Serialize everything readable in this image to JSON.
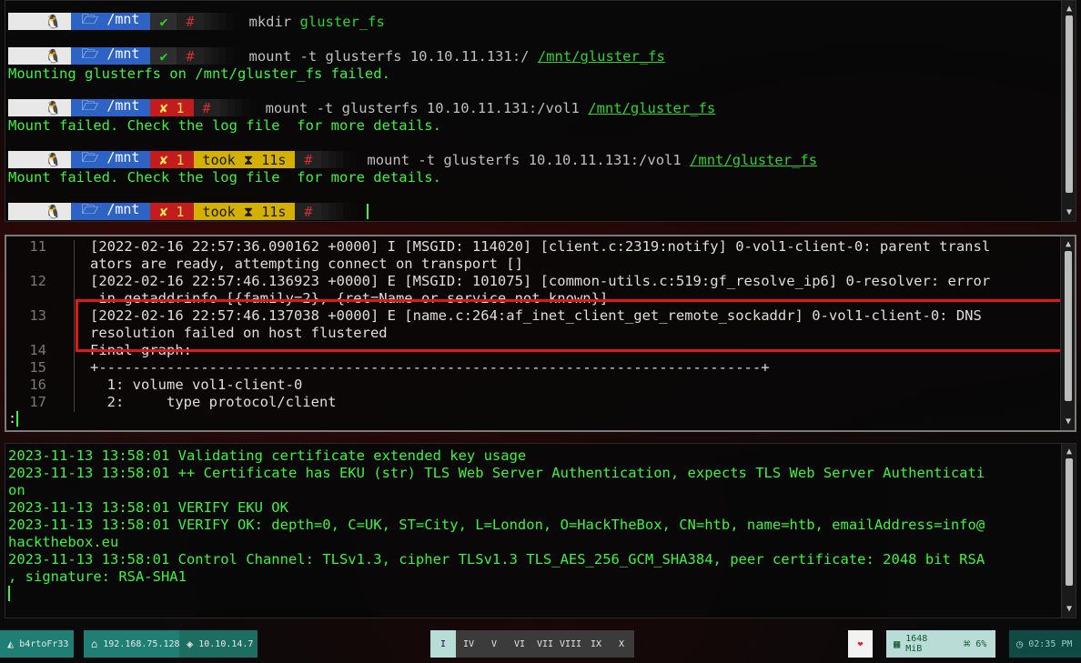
{
  "terminal_top": {
    "lines": [
      {
        "type": "prompt",
        "os_icon": "🐧",
        "dir": "🗁 /mnt",
        "status": "✔",
        "hash": "#",
        "cmd": "mkdir",
        "args": "gluster_fs"
      },
      {
        "type": "prompt",
        "os_icon": "🐧",
        "dir": "🗁 /mnt",
        "status": "✔",
        "hash": "#",
        "cmd": "mount",
        "args": "-t glusterfs 10.10.11.131:/",
        "path": "/mnt/gluster_fs"
      },
      {
        "type": "output",
        "text": "Mounting glusterfs on /mnt/gluster_fs failed."
      },
      {
        "type": "prompt",
        "os_icon": "🐧",
        "dir": "🗁 /mnt",
        "error": "✘ 1",
        "hash": "#",
        "cmd": "mount",
        "args": "-t glusterfs 10.10.11.131:/vol1",
        "path": "/mnt/gluster_fs"
      },
      {
        "type": "output",
        "text": "Mount failed. Check the log file  for more details."
      },
      {
        "type": "prompt",
        "os_icon": "🐧",
        "dir": "🗁 /mnt",
        "error": "✘ 1",
        "took": "took ⧗ 11s",
        "hash": "#",
        "cmd": "mount",
        "args": "-t glusterfs 10.10.11.131:/vol1",
        "path": "/mnt/gluster_fs"
      },
      {
        "type": "output",
        "text": "Mount failed. Check the log file  for more details."
      },
      {
        "type": "prompt",
        "os_icon": "🐧",
        "dir": "🗁 /mnt",
        "error": "✘ 1",
        "took": "took ⧗ 11s",
        "hash": "#"
      }
    ]
  },
  "vim": {
    "rows": [
      {
        "num": "11",
        "text": "[2022-02-16 22:57:36.090162 +0000] I [MSGID: 114020] [client.c:2319:notify] 0-vol1-client-0: parent transl"
      },
      {
        "num": "",
        "text": "ators are ready, attempting connect on transport []"
      },
      {
        "num": "12",
        "text": "[2022-02-16 22:57:46.136923 +0000] E [MSGID: 101075] [common-utils.c:519:gf_resolve_ip6] 0-resolver: error"
      },
      {
        "num": "",
        "text": " in getaddrinfo [{family=2}, {ret=Name or service not known}]"
      },
      {
        "num": "13",
        "text": "[2022-02-16 22:57:46.137038 +0000] E [name.c:264:af_inet_client_get_remote_sockaddr] 0-vol1-client-0: DNS"
      },
      {
        "num": "",
        "text": "resolution failed on host flustered"
      },
      {
        "num": "14",
        "text": "Final graph:"
      },
      {
        "num": "15",
        "text": "+------------------------------------------------------------------------------+"
      },
      {
        "num": "16",
        "text": "  1: volume vol1-client-0"
      },
      {
        "num": "17",
        "text": "  2:     type protocol/client"
      }
    ],
    "cmdline": ":"
  },
  "terminal_bottom": {
    "lines": [
      "2023-11-13 13:58:01 Validating certificate extended key usage",
      "2023-11-13 13:58:01 ++ Certificate has EKU (str) TLS Web Server Authentication, expects TLS Web Server Authenticati",
      "on",
      "2023-11-13 13:58:01 VERIFY EKU OK",
      "2023-11-13 13:58:01 VERIFY OK: depth=0, C=UK, ST=City, L=London, O=HackTheBox, CN=htb, name=htb, emailAddress=info@",
      "hackthebox.eu",
      "2023-11-13 13:58:01 Control Channel: TLSv1.3, cipher TLSv1.3 TLS_AES_256_GCM_SHA384, peer certificate: 2048 bit RSA",
      ", signature: RSA-SHA1"
    ]
  },
  "statusbar": {
    "user": "b4rtoFr33",
    "local_ip": "192.168.75.128",
    "vpn_ip": "10.10.14.7",
    "workspaces": [
      "I",
      "IV",
      "V",
      "VI",
      "VII",
      "VIII",
      "IX",
      "X"
    ],
    "active_workspace": "I",
    "memory": "1648 MiB",
    "cpu": "6%",
    "time": "02:35 PM",
    "heart": "❤"
  }
}
